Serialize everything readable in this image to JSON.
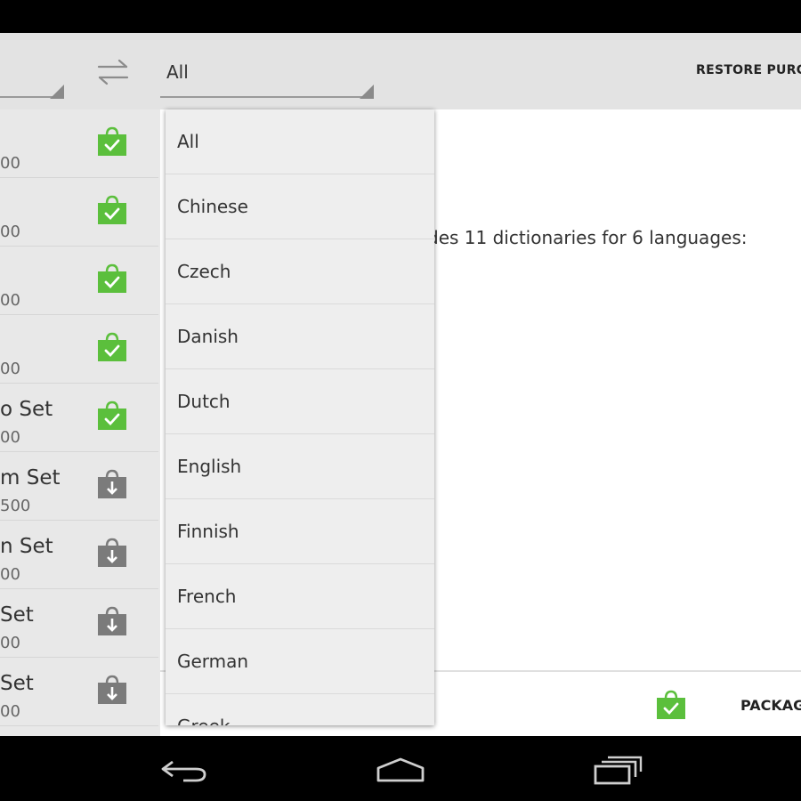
{
  "header": {
    "spinner_value": "All",
    "restore_label": "RESTORE PURCHASES",
    "swap_icon": "swap-arrows-icon"
  },
  "left_list": [
    {
      "title": "",
      "sub": "00",
      "status": "purchased"
    },
    {
      "title": "",
      "sub": "00",
      "status": "purchased"
    },
    {
      "title": "",
      "sub": "00",
      "status": "purchased"
    },
    {
      "title": "",
      "sub": "00",
      "status": "purchased"
    },
    {
      "title": "o Set",
      "sub": "00",
      "status": "purchased"
    },
    {
      "title": "m Set",
      "sub": "500",
      "status": "available"
    },
    {
      "title": "n Set",
      "sub": "00",
      "status": "available"
    },
    {
      "title": "Set",
      "sub": "00",
      "status": "available"
    },
    {
      "title": "Set",
      "sub": "00",
      "status": "available"
    }
  ],
  "content": {
    "description": "des 11 dictionaries for 6 languages:"
  },
  "footer": {
    "package_label": "PACKAGE"
  },
  "dropdown": {
    "options": [
      "All",
      "Chinese",
      "Czech",
      "Danish",
      "Dutch",
      "English",
      "Finnish",
      "French",
      "German",
      "Greek"
    ]
  },
  "colors": {
    "purchased": "#5bbf3c",
    "available": "#7b7b7b",
    "header_bg": "#e3e3e3"
  },
  "navbar": {
    "icons": [
      "back-icon",
      "home-icon",
      "recents-icon"
    ]
  }
}
